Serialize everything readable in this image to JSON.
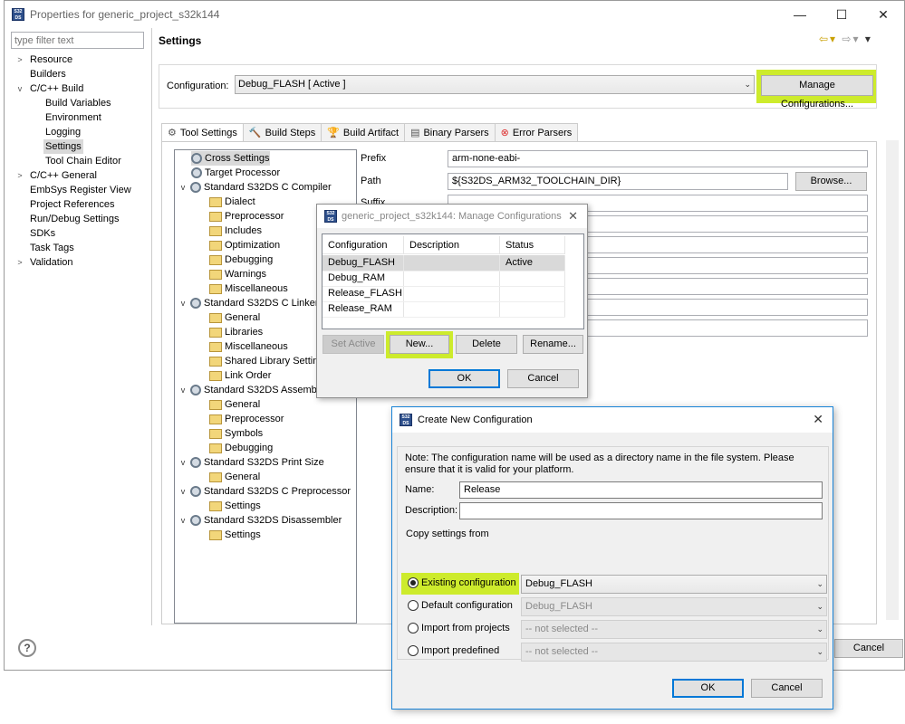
{
  "main_window": {
    "title": "Properties for generic_project_s32k144",
    "icon_text": "S32 DS",
    "controls": {
      "minimize": "—",
      "maximize": "☐",
      "close": "✕"
    }
  },
  "nav": {
    "filter_placeholder": "type filter text",
    "items": [
      {
        "label": "Resource"
      },
      {
        "label": "Builders"
      },
      {
        "label": "C/C++ Build"
      },
      {
        "label": "Build Variables"
      },
      {
        "label": "Environment"
      },
      {
        "label": "Logging"
      },
      {
        "label": "Settings"
      },
      {
        "label": "Tool Chain Editor"
      },
      {
        "label": "C/C++ General"
      },
      {
        "label": "EmbSys Register View"
      },
      {
        "label": "Project References"
      },
      {
        "label": "Run/Debug Settings"
      },
      {
        "label": "SDKs"
      },
      {
        "label": "Task Tags"
      },
      {
        "label": "Validation"
      }
    ]
  },
  "page": {
    "title": "Settings",
    "config_label": "Configuration:",
    "config_value": "Debug_FLASH  [ Active ]",
    "manage_button": "Manage Configurations..."
  },
  "tabs": [
    "Tool Settings",
    "Build Steps",
    "Build Artifact",
    "Binary Parsers",
    "Error Parsers"
  ],
  "tool_tree": [
    "Cross Settings",
    "Target Processor",
    "Standard S32DS C Compiler",
    "Dialect",
    "Preprocessor",
    "Includes",
    "Optimization",
    "Debugging",
    "Warnings",
    "Miscellaneous",
    "Standard S32DS C Linker",
    "General",
    "Libraries",
    "Miscellaneous",
    "Shared Library Settings",
    "Link Order",
    "Standard S32DS Assembler",
    "General",
    "Preprocessor",
    "Symbols",
    "Debugging",
    "Standard S32DS Print Size",
    "General",
    "Standard S32DS C Preprocessor",
    "Settings",
    "Standard S32DS Disassembler",
    "Settings"
  ],
  "fields": {
    "prefix_label": "Prefix",
    "prefix_value": "arm-none-eabi-",
    "path_label": "Path",
    "path_value": "${S32DS_ARM32_TOOLCHAIN_DIR}",
    "suffix_label": "Suffix",
    "browse_button": "Browse..."
  },
  "footer": {
    "help": "?",
    "cancel": "Cancel"
  },
  "manage_dialog": {
    "title": "generic_project_s32k144: Manage Configurations",
    "columns": [
      "Configuration",
      "Description",
      "Status"
    ],
    "rows": [
      {
        "config": "Debug_FLASH",
        "description": "",
        "status": "Active"
      },
      {
        "config": "Debug_RAM",
        "description": "",
        "status": ""
      },
      {
        "config": "Release_FLASH",
        "description": "",
        "status": ""
      },
      {
        "config": "Release_RAM",
        "description": "",
        "status": ""
      }
    ],
    "buttons": {
      "set_active": "Set Active",
      "new": "New...",
      "delete": "Delete",
      "rename": "Rename...",
      "ok": "OK",
      "cancel": "Cancel"
    }
  },
  "create_dialog": {
    "title": "Create New Configuration",
    "note": "Note: The configuration name will be used as a directory name in the file system.  Please ensure that it is valid for your platform.",
    "name_label": "Name:",
    "name_value": "Release",
    "description_label": "Description:",
    "description_value": "",
    "copy_legend": "Copy settings from",
    "options": [
      {
        "label": "Existing configuration",
        "value": "Debug_FLASH",
        "checked": true
      },
      {
        "label": "Default configuration",
        "value": "Debug_FLASH",
        "checked": false
      },
      {
        "label": "Import from projects",
        "value": "-- not selected --",
        "checked": false
      },
      {
        "label": "Import predefined",
        "value": "-- not selected --",
        "checked": false
      }
    ],
    "ok": "OK",
    "cancel": "Cancel"
  },
  "colors": {
    "highlight": "#cdeb2c",
    "accent": "#0078d7"
  }
}
